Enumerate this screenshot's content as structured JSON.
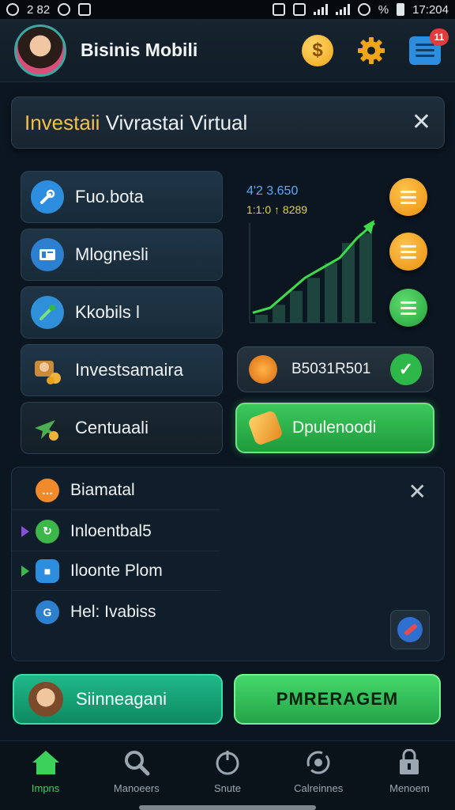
{
  "status_bar": {
    "left_text": "2 82",
    "battery_pct": "%",
    "time": "17:204"
  },
  "app_bar": {
    "title": "Bisinis Mobili",
    "coin_symbol": "$",
    "message_badge": "11",
    "icons": [
      "avatar",
      "coin-icon",
      "gear-icon",
      "message-icon"
    ]
  },
  "banner": {
    "title_highlight": "Investaii",
    "title_rest": " Vivrastai Virtual",
    "close_label": "✕"
  },
  "menu": {
    "items": [
      {
        "label": "Fuo.bota",
        "icon": "wrench-icon",
        "color": "#2d8ee0"
      },
      {
        "label": "Mlognesli",
        "icon": "card-icon",
        "color": "#2d7fd0"
      },
      {
        "label": "Kkobils  l",
        "icon": "tool-icon",
        "color": "#2f8fd8"
      },
      {
        "label": "Investsamaira",
        "icon": "coins-icon",
        "color": "#c98a3a"
      },
      {
        "label": "Centuaali",
        "icon": "plane-icon",
        "color": "#4caf50"
      }
    ]
  },
  "chart": {
    "label_top": "4'2 3.650",
    "label_bottom": "1:1:0 ↑ 8289",
    "bars": [
      0.08,
      0.18,
      0.32,
      0.45,
      0.6,
      0.8,
      0.9
    ],
    "line": [
      0.1,
      0.15,
      0.3,
      0.45,
      0.55,
      0.65,
      0.85,
      1.0
    ],
    "accent_green": "#3ddc4a",
    "buttons": [
      {
        "icon": "menu-icon",
        "color": "#f0a418"
      },
      {
        "icon": "menu-icon",
        "color": "#f0a418"
      },
      {
        "icon": "menu-icon",
        "color": "#2fb84a"
      }
    ]
  },
  "value_card": {
    "text": "B5031R501",
    "check": "✓"
  },
  "deposit": {
    "label": "Dpulenoodi"
  },
  "panel": {
    "close_label": "✕",
    "rows": [
      {
        "label": "Biamatal",
        "icon": "chat-icon",
        "color": "#f08a2a",
        "arrow": ""
      },
      {
        "label": "Inloentbal5",
        "icon": "refresh-icon",
        "color": "#3cb84a",
        "arrow": "#8a4fd8"
      },
      {
        "label": "Iloonte Plom",
        "icon": "square-icon",
        "color": "#2d8ee0",
        "arrow": "#3cb84a"
      },
      {
        "label": "Hel: Ivabiss",
        "icon": "g-icon",
        "color": "#2d7fd0",
        "arrow": ""
      }
    ]
  },
  "actions": {
    "left_label": "Siinneagani",
    "right_label": "PMRERAGEM"
  },
  "nav": {
    "items": [
      {
        "label": "Impns",
        "icon": "home-icon",
        "active": true
      },
      {
        "label": "Manoeers",
        "icon": "search-icon",
        "active": false
      },
      {
        "label": "Snute",
        "icon": "power-icon",
        "active": false
      },
      {
        "label": "Calreinnes",
        "icon": "sync-icon",
        "active": false
      },
      {
        "label": "Menoem",
        "icon": "lock-icon",
        "active": false
      }
    ]
  }
}
